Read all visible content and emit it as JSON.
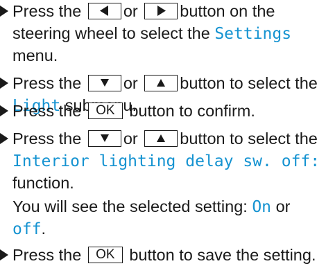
{
  "steps": [
    {
      "text1": "Press the",
      "btn_left_label": "◀",
      "text2": "or",
      "btn_right_label": "▶",
      "text3": "button on the",
      "text4": "steering wheel to select the",
      "menu": "Settings",
      "text5": "menu."
    },
    {
      "text1": "Press the",
      "btn_down_label": "▼",
      "text2": "or",
      "btn_up_label": "▲",
      "text3": "button to select the",
      "submenu": "Light",
      "text4": "submenu."
    },
    {
      "text1": "Press the",
      "btn_ok_label": "OK",
      "text2": "button to confirm."
    },
    {
      "text1": "Press the",
      "btn_down_label": "▼",
      "text2": "or",
      "btn_up_label": "▲",
      "text3": "button to select the",
      "function_name": "Interior lighting delay sw. off:",
      "text4": "function.",
      "text5": "You will see the selected setting:",
      "value_on": "On",
      "text6": "or",
      "value_off": "off",
      "text7": "."
    },
    {
      "text1": "Press the",
      "btn_ok_label": "OK",
      "text2": "button to save the setting."
    }
  ],
  "colors": {
    "display_text": "#1593d1",
    "body_text": "#1a1a1a"
  },
  "icons": {
    "bullet": "right-triangle-bullet"
  }
}
